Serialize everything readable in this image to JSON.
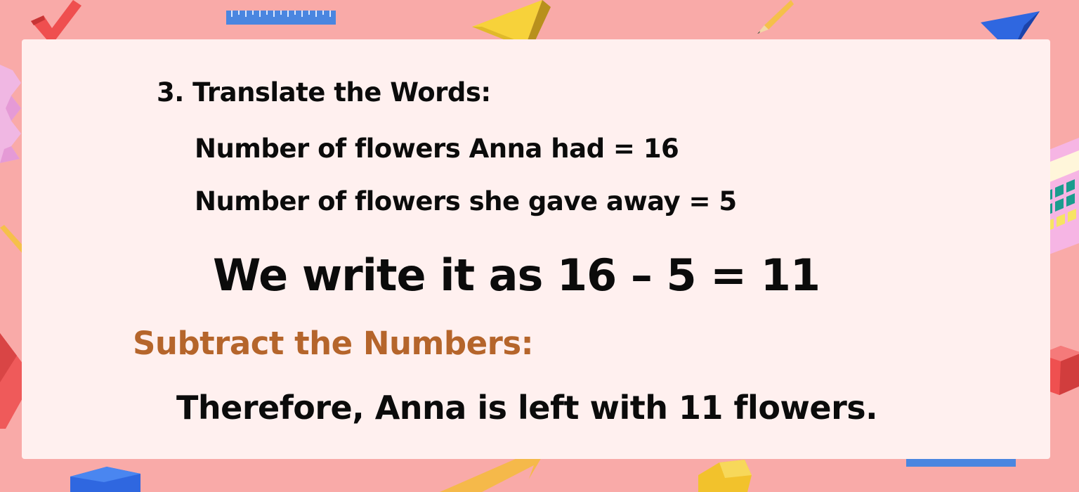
{
  "slide": {
    "heading": "3. Translate the Words:",
    "fact_1": "Number of flowers Anna had = 16",
    "fact_2": "Number of flowers she gave away = 5",
    "equation": "We write it as 16 – 5 = 11",
    "subtract_heading": "Subtract the Numbers:",
    "conclusion": "Therefore, Anna is left with 11 flowers."
  },
  "colors": {
    "background": "#f9aaa8",
    "card": "#fff0ef",
    "text": "#0b0b0b",
    "accent_heading": "#b5652b"
  },
  "decorations": [
    "red-checkmark-icon",
    "blue-ruler-icon",
    "yellow-triangle-block-icon",
    "pencil-icon",
    "blue-pyramid-icon",
    "pink-zigzag-block-icon",
    "calculator-icon",
    "red-diamond-block-icon",
    "red-cube-icon",
    "blue-cube-icon",
    "set-square-icon",
    "yellow-hexagon-block-icon"
  ]
}
